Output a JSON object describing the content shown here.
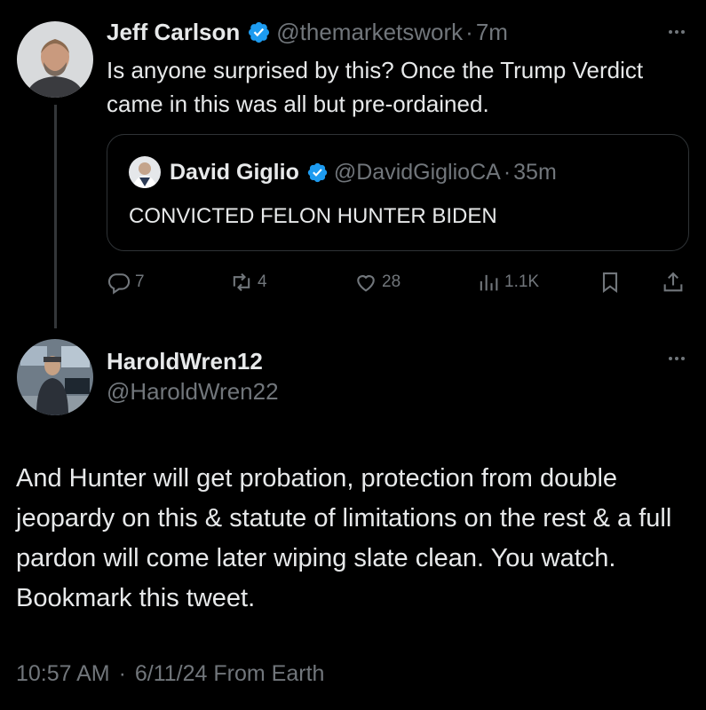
{
  "tweet1": {
    "name": "Jeff Carlson",
    "handle": "@themarketswork",
    "sep": "·",
    "time": "7m",
    "text": "Is anyone surprised by this? Once the Trump Verdict came in this was all but pre-ordained.",
    "quote": {
      "name": "David Giglio",
      "handle": "@DavidGiglioCA",
      "sep": "·",
      "time": "35m",
      "text": "CONVICTED FELON HUNTER BIDEN"
    },
    "stats": {
      "replies": "7",
      "reposts": "4",
      "likes": "28",
      "views": "1.1K"
    }
  },
  "tweet2": {
    "name": "HaroldWren12",
    "handle": "@HaroldWren22",
    "text": "And Hunter will get probation, protection from double jeopardy on this & statute of limitations on the rest & a full pardon will come later wiping slate clean. You watch. Bookmark this tweet.",
    "time": "10:57 AM",
    "sep": "·",
    "date": "6/11/24",
    "source": "From Earth"
  },
  "colors": {
    "background": "#000000",
    "text": "#e7e9ea",
    "muted": "#71767b",
    "verified": "#1d9bf0",
    "border": "#2f3336"
  }
}
